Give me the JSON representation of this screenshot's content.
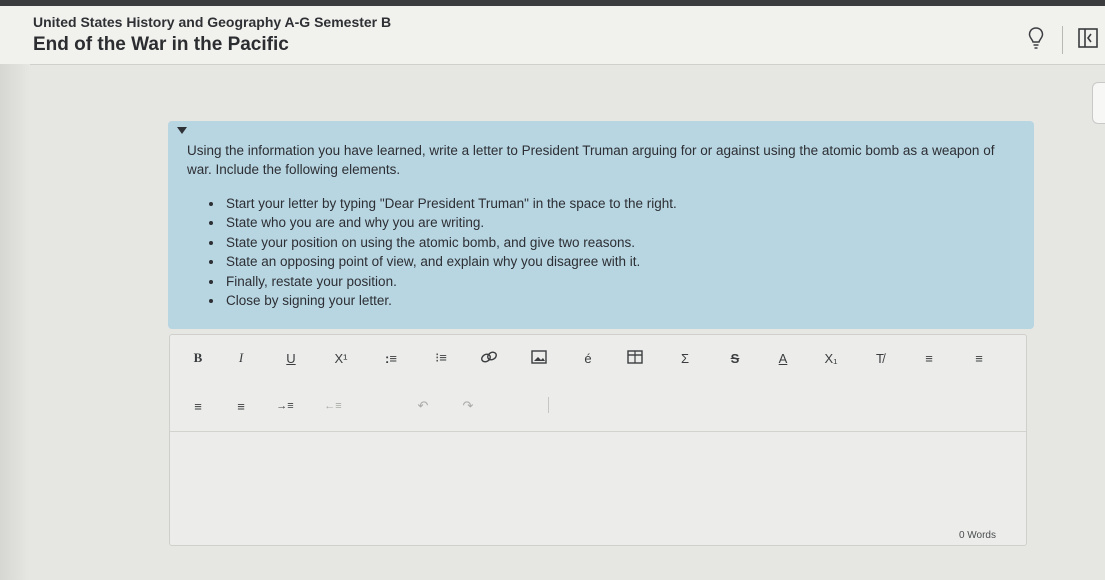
{
  "header": {
    "course_title": "United States History and Geography A-G Semester B",
    "lesson_title": "End of the War in the Pacific",
    "icons": [
      "lightbulb-icon",
      "side-panel-icon"
    ]
  },
  "prompt": {
    "instructions": "Using the information you have learned, write a letter to President Truman arguing for or against using the atomic bomb as a weapon of war. Include the following elements.",
    "bullets": [
      "Start your letter by typing \"Dear President Truman\" in the space to the right.",
      "State who you are and why you are writing.",
      "State your position on using the atomic bomb, and give two reasons.",
      "State an opposing point of view, and explain why you disagree with it.",
      "Finally, restate your position.",
      "Close by signing your letter."
    ]
  },
  "editor": {
    "toolbar": {
      "bold": "B",
      "italic": "I",
      "underline": "U",
      "superscript": "X¹",
      "bullet_list": ":≡",
      "numbered_list": "⁝≡",
      "link": "🔗",
      "image": "▣",
      "special_char": "é",
      "table": "⊞",
      "equation": "Σ",
      "strikethrough": "S",
      "font_color": "A",
      "subscript": "X₁",
      "clear_format": "T̸",
      "align_left": "≡",
      "align_center": "≡",
      "align_right": "≡",
      "justify": "≡",
      "indent": "→≡",
      "outdent": "←≡",
      "undo": "↶",
      "redo": "↷"
    },
    "word_count": "0 Words"
  },
  "colors": {
    "prompt_background": "#b8d5e2",
    "page_background": "#e6e7e3"
  }
}
